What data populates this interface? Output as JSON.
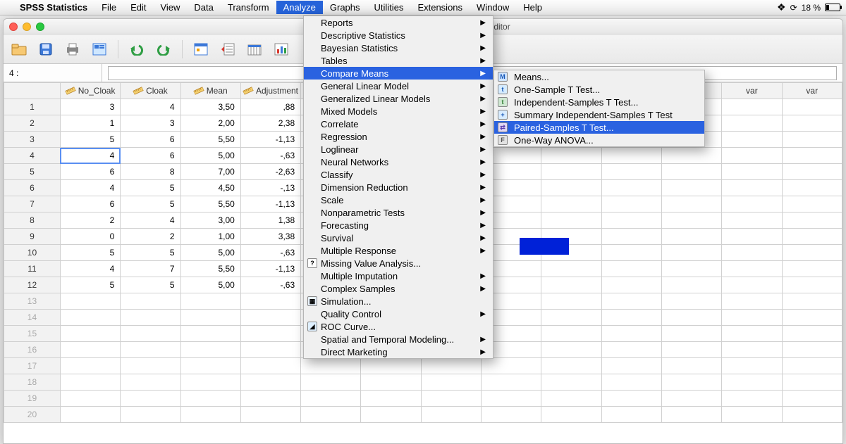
{
  "menubar": {
    "apple": "",
    "items": [
      "SPSS Statistics",
      "File",
      "Edit",
      "View",
      "Data",
      "Transform",
      "Analyze",
      "Graphs",
      "Utilities",
      "Extensions",
      "Window",
      "Help"
    ],
    "active_index": 6,
    "right": {
      "dropbox_icon": "dropbox-icon",
      "status_icon": "sync-icon",
      "battery_pct": "18 %",
      "battery_icon": "battery-icon"
    }
  },
  "window": {
    "title": "] - IBM SPSS Statistics Data Editor",
    "traffic": [
      "close",
      "minimize",
      "zoom"
    ]
  },
  "toolbar": {
    "buttons": [
      "open-icon",
      "save-icon",
      "print-icon",
      "preview-icon",
      "undo-icon",
      "redo-icon",
      "goto-icon",
      "insert-case-icon",
      "insert-var-icon",
      "chart-icon"
    ]
  },
  "formula": {
    "cell_ref": "4 :",
    "value": ""
  },
  "columns": {
    "vars": [
      "No_Cloak",
      "Cloak",
      "Mean",
      "Adjustment"
    ],
    "empty": [
      "var",
      "var",
      "var",
      "var",
      "var",
      "var",
      "var",
      "var",
      "var"
    ]
  },
  "rows": [
    {
      "n": 1,
      "No_Cloak": "3",
      "Cloak": "4",
      "Mean": "3,50",
      "Adjustment": ",88"
    },
    {
      "n": 2,
      "No_Cloak": "1",
      "Cloak": "3",
      "Mean": "2,00",
      "Adjustment": "2,38"
    },
    {
      "n": 3,
      "No_Cloak": "5",
      "Cloak": "6",
      "Mean": "5,50",
      "Adjustment": "-1,13"
    },
    {
      "n": 4,
      "No_Cloak": "4",
      "Cloak": "6",
      "Mean": "5,00",
      "Adjustment": "-,63"
    },
    {
      "n": 5,
      "No_Cloak": "6",
      "Cloak": "8",
      "Mean": "7,00",
      "Adjustment": "-2,63"
    },
    {
      "n": 6,
      "No_Cloak": "4",
      "Cloak": "5",
      "Mean": "4,50",
      "Adjustment": "-,13"
    },
    {
      "n": 7,
      "No_Cloak": "6",
      "Cloak": "5",
      "Mean": "5,50",
      "Adjustment": "-1,13"
    },
    {
      "n": 8,
      "No_Cloak": "2",
      "Cloak": "4",
      "Mean": "3,00",
      "Adjustment": "1,38"
    },
    {
      "n": 9,
      "No_Cloak": "0",
      "Cloak": "2",
      "Mean": "1,00",
      "Adjustment": "3,38"
    },
    {
      "n": 10,
      "No_Cloak": "5",
      "Cloak": "5",
      "Mean": "5,00",
      "Adjustment": "-,63"
    },
    {
      "n": 11,
      "No_Cloak": "4",
      "Cloak": "7",
      "Mean": "5,50",
      "Adjustment": "-1,13"
    },
    {
      "n": 12,
      "No_Cloak": "5",
      "Cloak": "5",
      "Mean": "5,00",
      "Adjustment": "-,63"
    }
  ],
  "empty_row_start": 13,
  "empty_row_end": 20,
  "selected_row": 4,
  "analyze_menu": {
    "items": [
      {
        "label": "Reports",
        "arrow": true
      },
      {
        "label": "Descriptive Statistics",
        "arrow": true
      },
      {
        "label": "Bayesian Statistics",
        "arrow": true
      },
      {
        "label": "Tables",
        "arrow": true
      },
      {
        "label": "Compare Means",
        "arrow": true,
        "hi": true
      },
      {
        "label": "General Linear Model",
        "arrow": true
      },
      {
        "label": "Generalized Linear Models",
        "arrow": true
      },
      {
        "label": "Mixed Models",
        "arrow": true
      },
      {
        "label": "Correlate",
        "arrow": true
      },
      {
        "label": "Regression",
        "arrow": true
      },
      {
        "label": "Loglinear",
        "arrow": true
      },
      {
        "label": "Neural Networks",
        "arrow": true
      },
      {
        "label": "Classify",
        "arrow": true
      },
      {
        "label": "Dimension Reduction",
        "arrow": true
      },
      {
        "label": "Scale",
        "arrow": true
      },
      {
        "label": "Nonparametric Tests",
        "arrow": true
      },
      {
        "label": "Forecasting",
        "arrow": true
      },
      {
        "label": "Survival",
        "arrow": true
      },
      {
        "label": "Multiple Response",
        "arrow": true
      },
      {
        "label": "Missing Value Analysis...",
        "arrow": false,
        "icon": "mva"
      },
      {
        "label": "Multiple Imputation",
        "arrow": true
      },
      {
        "label": "Complex Samples",
        "arrow": true
      },
      {
        "label": "Simulation...",
        "arrow": false,
        "icon": "sim"
      },
      {
        "label": "Quality Control",
        "arrow": true
      },
      {
        "label": "ROC Curve...",
        "arrow": false,
        "icon": "roc"
      },
      {
        "label": "Spatial and Temporal Modeling...",
        "arrow": true
      },
      {
        "label": "Direct Marketing",
        "arrow": true
      }
    ]
  },
  "compare_means_submenu": {
    "items": [
      {
        "icon": "m",
        "label": "Means..."
      },
      {
        "icon": "t",
        "label": "One-Sample T Test..."
      },
      {
        "icon": "i",
        "label": "Independent-Samples T Test..."
      },
      {
        "icon": "s",
        "label": "Summary Independent-Samples T Test"
      },
      {
        "icon": "p",
        "label": "Paired-Samples T Test...",
        "hi": true
      },
      {
        "icon": "o",
        "label": "One-Way ANOVA..."
      }
    ]
  }
}
